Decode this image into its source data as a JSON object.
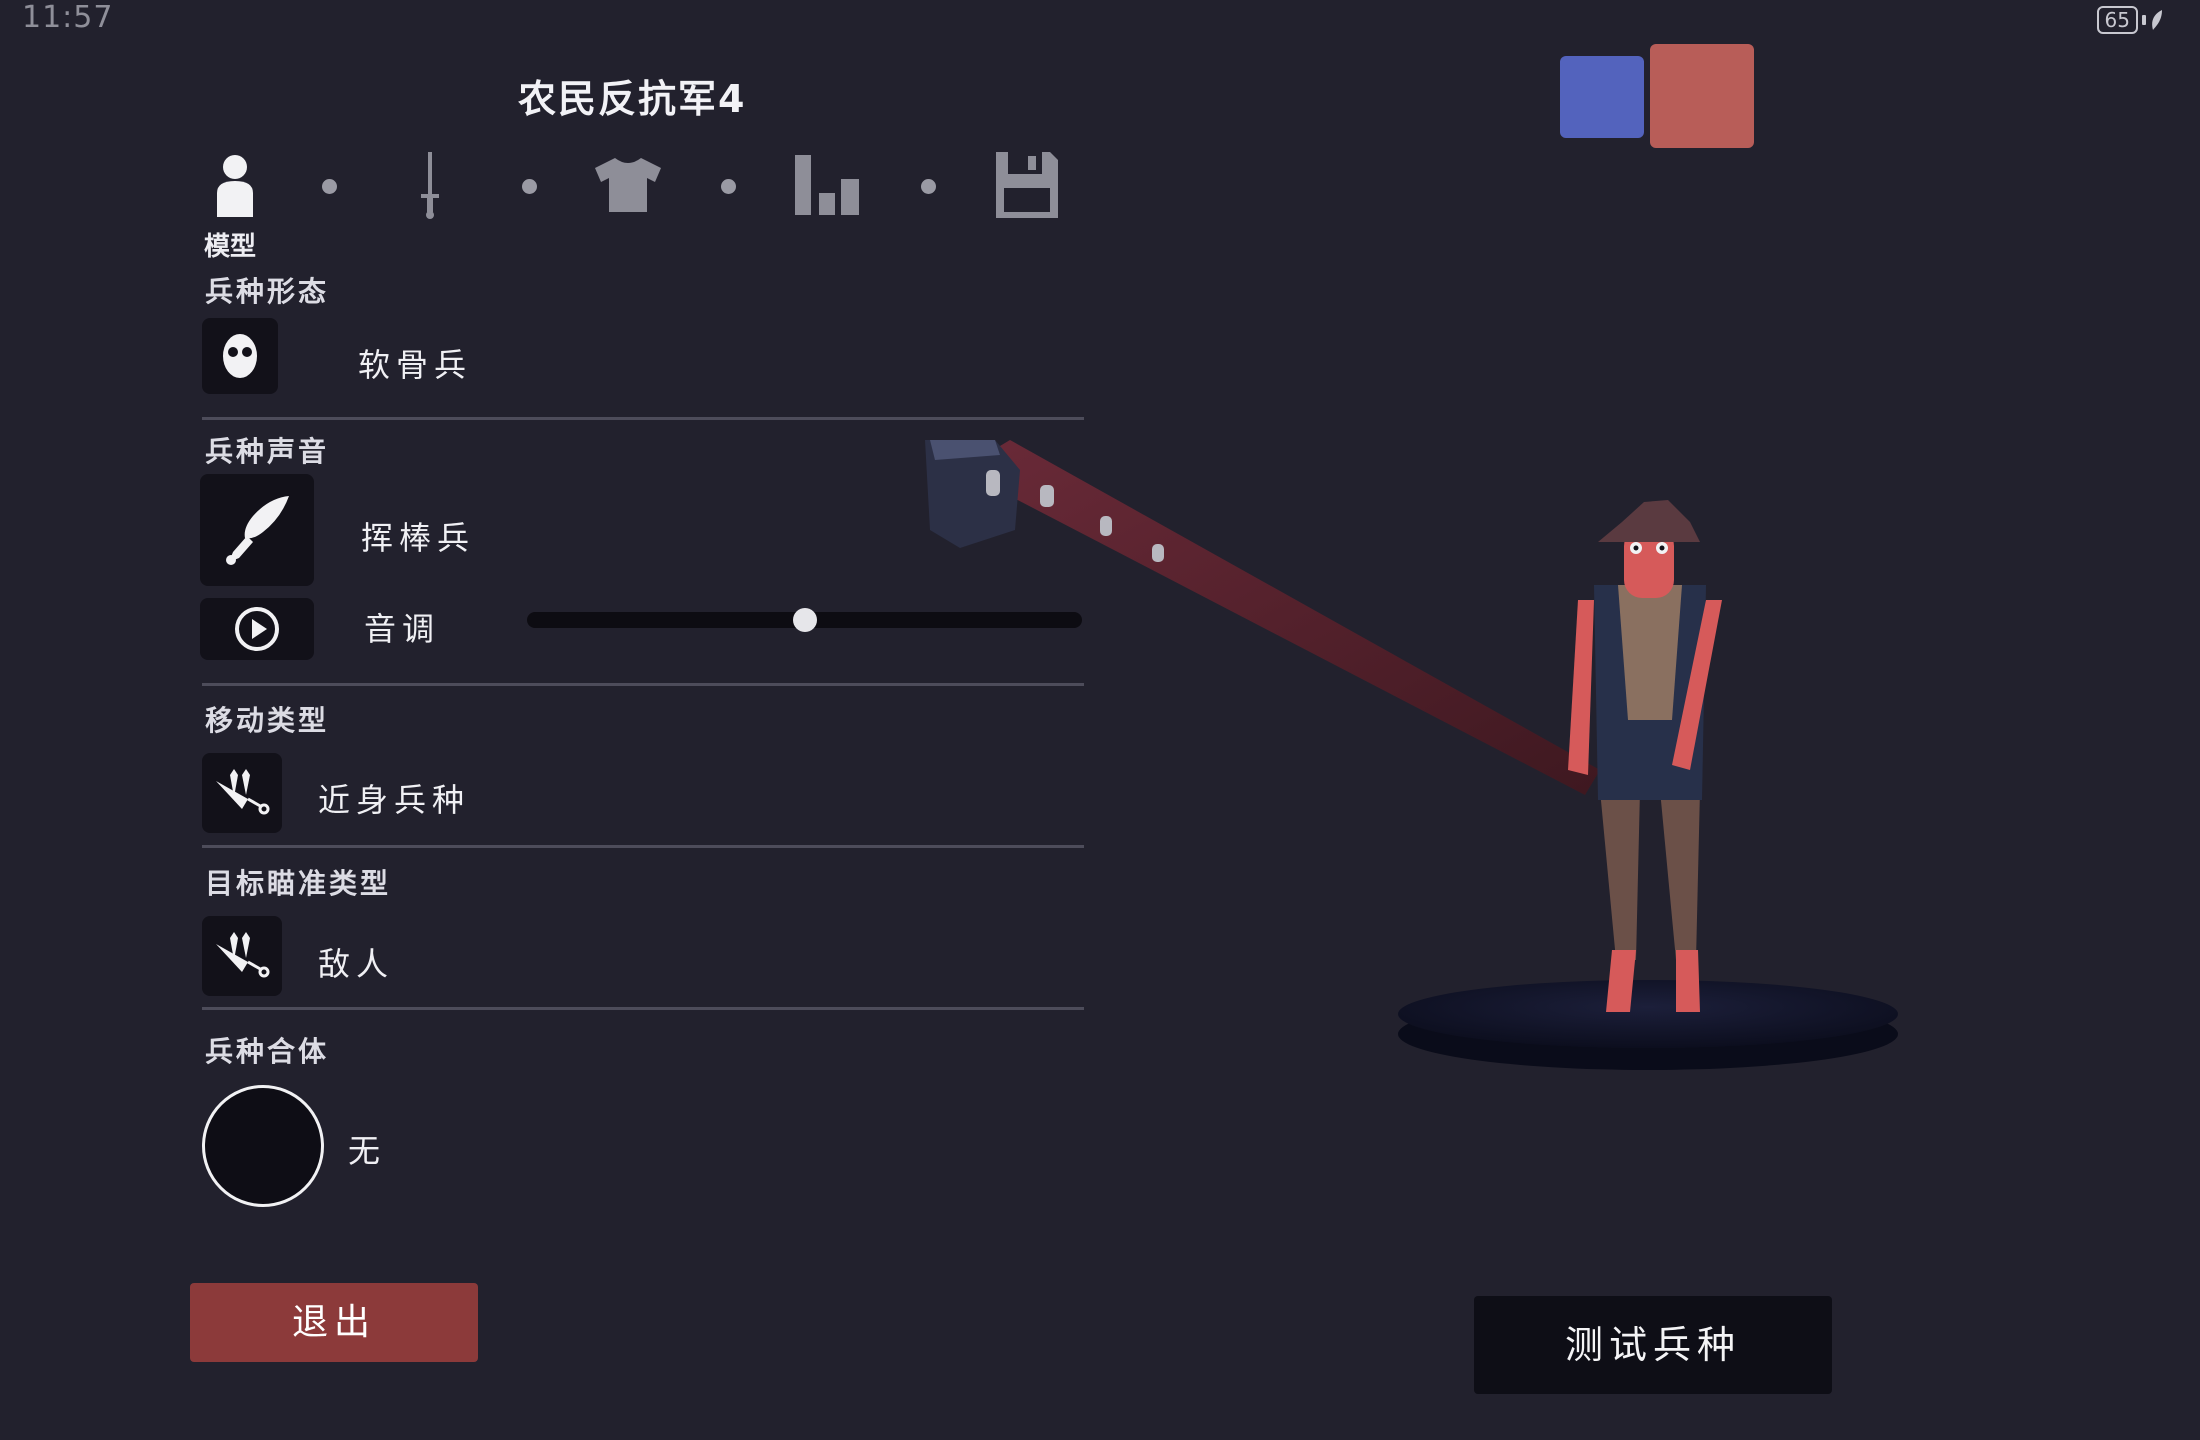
{
  "status_bar": {
    "time": "11:57",
    "battery": "65"
  },
  "header": {
    "unit_name": "农民反抗军4"
  },
  "tabs": [
    {
      "icon": "person-icon",
      "label": "模型",
      "active": true
    },
    {
      "icon": "sword-icon"
    },
    {
      "icon": "shirt-icon"
    },
    {
      "icon": "bar-chart-icon"
    },
    {
      "icon": "save-disk-icon"
    }
  ],
  "sections": {
    "form": {
      "title": "兵种形态",
      "value": "软骨兵",
      "icon": "face-icon"
    },
    "voice": {
      "title": "兵种声音",
      "value": "挥棒兵",
      "icon": "club-icon",
      "pitch_label": "音调",
      "pitch_value": 0.5,
      "play_icon": "play-icon"
    },
    "movement": {
      "title": "移动类型",
      "value": "近身兵种",
      "icon": "movement-icon"
    },
    "targeting": {
      "title": "目标瞄准类型",
      "value": "敌人",
      "icon": "target-icon"
    },
    "combine": {
      "title": "兵种合体",
      "value": "无"
    }
  },
  "buttons": {
    "exit": "退出",
    "test": "测试兵种"
  },
  "team_colors": {
    "blue": "#5363bd",
    "red": "#b85d58"
  },
  "accents": {
    "exit_button": "#8c3a3a",
    "background": "#22212d"
  }
}
